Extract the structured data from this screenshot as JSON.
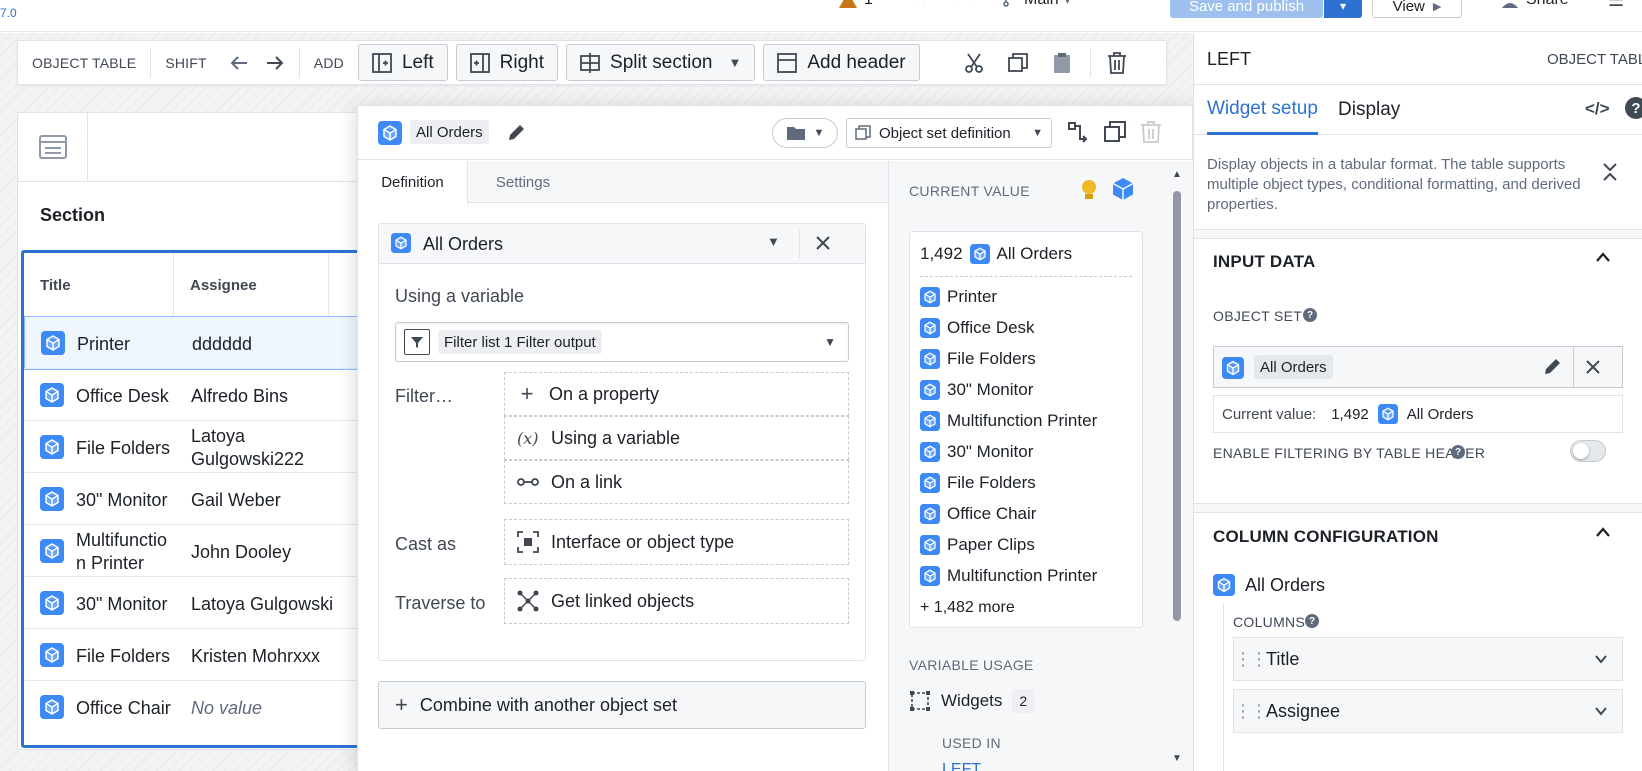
{
  "topbar": {
    "version": "7.0",
    "warnings_count": "1",
    "branch": "Main",
    "save_label": "Save and publish",
    "view_label": "View",
    "share_label": "Share"
  },
  "toolbar": {
    "object_table_label": "OBJECT TABLE",
    "shift_label": "SHIFT",
    "add_label": "ADD",
    "left_label": "Left",
    "right_label": "Right",
    "split_label": "Split section",
    "add_header_label": "Add header"
  },
  "widget": {
    "section_title": "Section",
    "columns": [
      "Title",
      "Assignee"
    ],
    "rows": [
      {
        "title": "Printer",
        "assignee": "dddddd"
      },
      {
        "title": "Office Desk",
        "assignee": "Alfredo Bins"
      },
      {
        "title": "File Folders",
        "assignee": "Latoya Gulgowski222"
      },
      {
        "title": "30\" Monitor",
        "assignee": "Gail Weber"
      },
      {
        "title": "Multifunction Printer",
        "assignee": "John Dooley"
      },
      {
        "title": "30\" Monitor",
        "assignee": "Latoya Gulgowski"
      },
      {
        "title": "File Folders",
        "assignee": "Kristen Mohrxxx"
      },
      {
        "title": "Office Chair",
        "assignee": "No value"
      }
    ]
  },
  "popover": {
    "name": "All Orders",
    "definition_select": "Object set definition",
    "tabs": [
      "Definition",
      "Settings"
    ],
    "def_object_set": "All Orders",
    "using_variable_label": "Using a variable",
    "variable_value": "Filter list 1 Filter output",
    "filter_label": "Filter…",
    "cast_label": "Cast as",
    "traverse_label": "Traverse to",
    "options": {
      "on_property": "On a property",
      "using_variable": "Using a variable",
      "on_link": "On a link",
      "cast": "Interface or object type",
      "traverse": "Get linked objects"
    },
    "combine_label": "Combine with another object set",
    "current_value_label": "CURRENT VALUE",
    "current_count": "1,492",
    "current_name": "All Orders",
    "current_items": [
      "Printer",
      "Office Desk",
      "File Folders",
      "30\" Monitor",
      "Multifunction Printer",
      "30\" Monitor",
      "File Folders",
      "Office Chair",
      "Paper Clips",
      "Multifunction Printer"
    ],
    "more_label": "+ 1,482 more",
    "variable_usage_label": "VARIABLE USAGE",
    "widgets_label": "Widgets",
    "widgets_count": "2",
    "used_in_label": "USED IN",
    "used_in_value": "LEFT"
  },
  "rpanel": {
    "title": "LEFT",
    "subtitle": "OBJECT TABLE",
    "tabs": [
      "Widget setup",
      "Display"
    ],
    "description": "Display objects in a tabular format. The table supports multiple object types, conditional formatting, and derived properties.",
    "input_data_title": "INPUT DATA",
    "object_set_label": "OBJECT SET",
    "object_set_value": "All Orders",
    "current_value_label": "Current value:",
    "current_value_count": "1,492",
    "current_value_name": "All Orders",
    "filtering_label": "ENABLE FILTERING BY TABLE HEADER",
    "column_config_title": "COLUMN CONFIGURATION",
    "column_object": "All Orders",
    "columns_label": "COLUMNS",
    "columns": [
      "Title",
      "Assignee"
    ]
  },
  "colors": {
    "accent": "#2d72d2",
    "object_icon": "#3d8af7"
  }
}
